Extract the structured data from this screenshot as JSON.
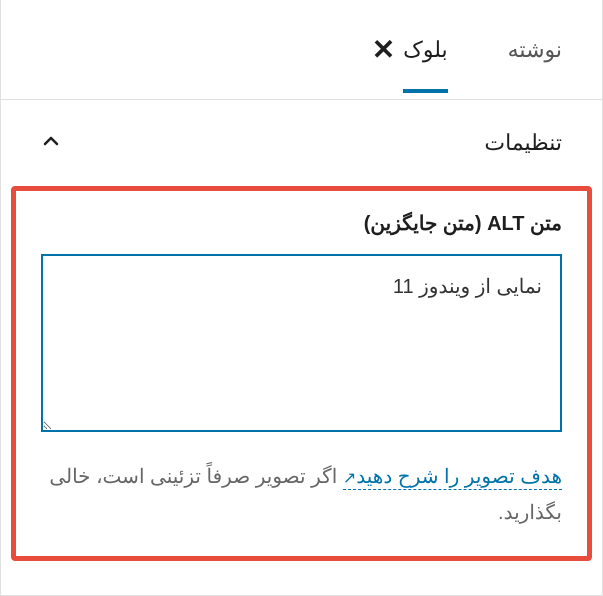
{
  "tabs": {
    "post": "نوشته",
    "block": "بلوک"
  },
  "section": {
    "settings": "تنظیمات"
  },
  "alt": {
    "label": "متن ALT (متن جایگزین)",
    "value": "نمایی از ویندوز 11"
  },
  "help": {
    "link_text": "هدف تصویر را شرح دهید",
    "suffix": " اگر تصویر صرفاً تزئینی است، خالی بگذارید."
  }
}
